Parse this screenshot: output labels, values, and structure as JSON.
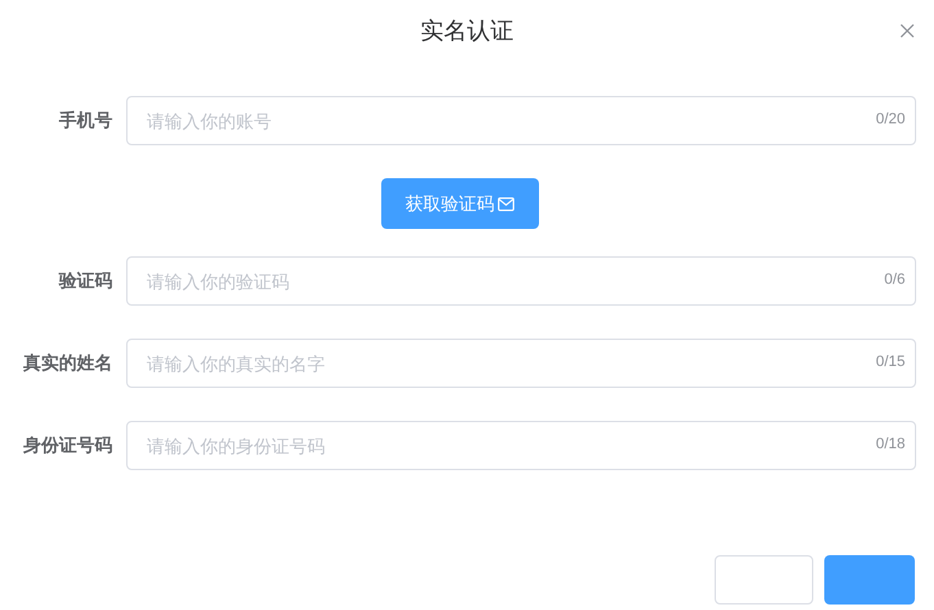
{
  "dialog": {
    "title": "实名认证",
    "fields": [
      {
        "label": "手机号",
        "placeholder": "请输入你的账号",
        "counter": "0/20"
      },
      {
        "kind": "action",
        "button": "获取验证码"
      },
      {
        "label": "验证码",
        "placeholder": "请输入你的验证码",
        "counter": "0/6"
      },
      {
        "label": "真实的姓名",
        "placeholder": "请输入你的真实的名字",
        "counter": "0/15"
      },
      {
        "label": "身份证号码",
        "placeholder": "请输入你的身份证号码",
        "counter": "0/18"
      }
    ]
  }
}
